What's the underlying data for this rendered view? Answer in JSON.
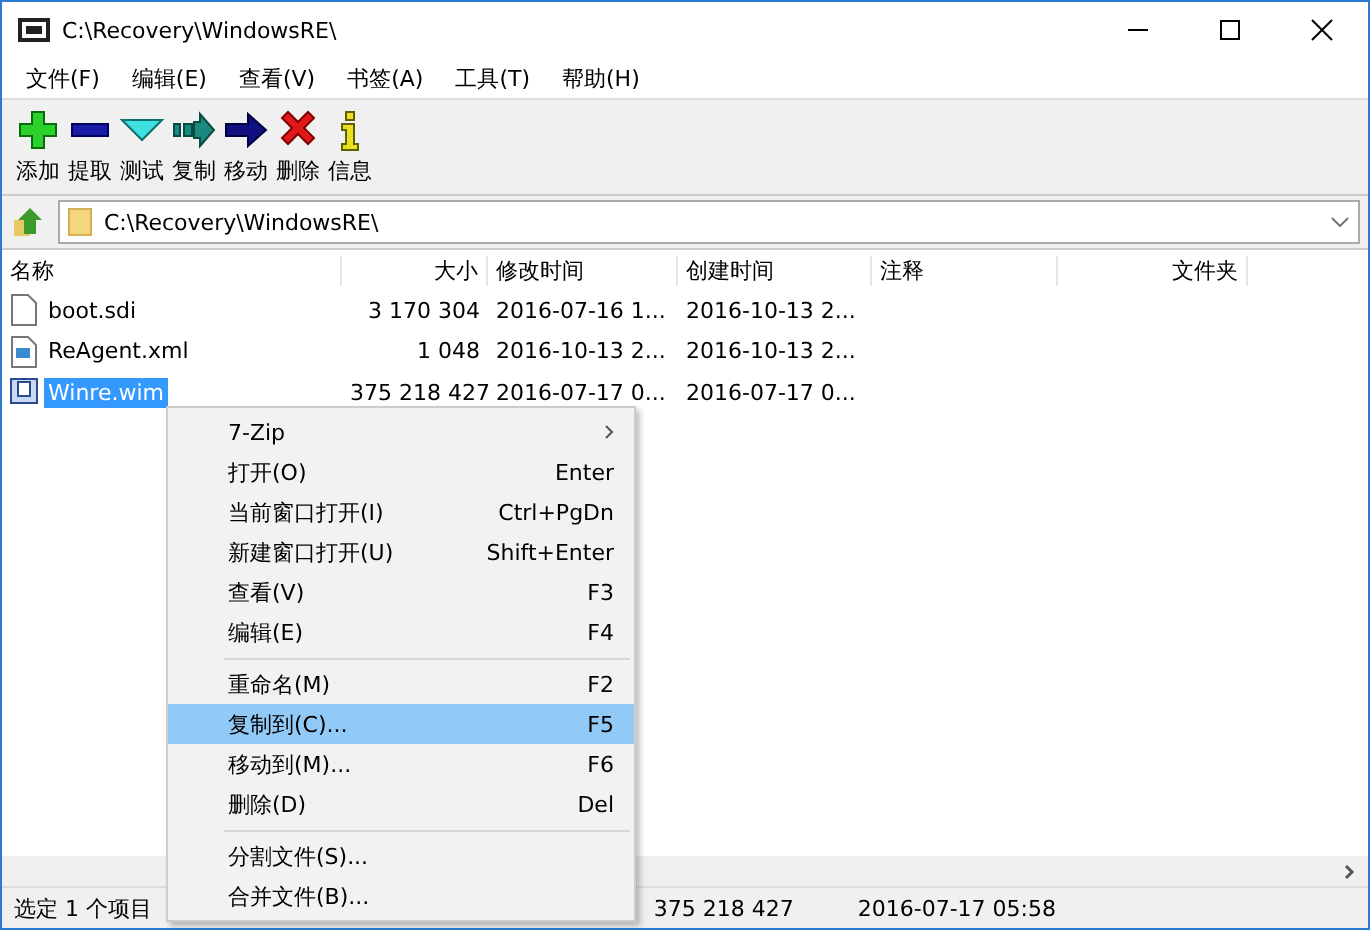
{
  "window": {
    "title": "C:\\Recovery\\WindowsRE\\"
  },
  "menu_bar": [
    "文件(F)",
    "编辑(E)",
    "查看(V)",
    "书签(A)",
    "工具(T)",
    "帮助(H)"
  ],
  "toolbar": [
    {
      "kind": "add",
      "label": "添加"
    },
    {
      "kind": "extract",
      "label": "提取"
    },
    {
      "kind": "test",
      "label": "测试"
    },
    {
      "kind": "copy",
      "label": "复制"
    },
    {
      "kind": "move",
      "label": "移动"
    },
    {
      "kind": "delete",
      "label": "删除"
    },
    {
      "kind": "info",
      "label": "信息"
    }
  ],
  "address": {
    "value": "C:\\Recovery\\WindowsRE\\"
  },
  "table": {
    "columns": [
      {
        "label": "名称"
      },
      {
        "label": "大小"
      },
      {
        "label": "修改时间"
      },
      {
        "label": "创建时间"
      },
      {
        "label": "注释"
      },
      {
        "label": "文件夹"
      }
    ],
    "rows": [
      {
        "kind": "file",
        "name": "boot.sdi",
        "size": "3 170 304",
        "modified": "2016-07-16 1...",
        "created": "2016-10-13 2...",
        "selected": false
      },
      {
        "kind": "xml",
        "name": "ReAgent.xml",
        "size": "1 048",
        "modified": "2016-10-13 2...",
        "created": "2016-10-13 2...",
        "selected": false
      },
      {
        "kind": "archive",
        "name": "Winre.wim",
        "size": "375 218 427",
        "modified": "2016-07-17 0...",
        "created": "2016-07-17 0...",
        "selected": true
      }
    ]
  },
  "context_menu": {
    "groups": [
      [
        {
          "label": "7-Zip",
          "submenu": true,
          "selected": false
        },
        {
          "label": "打开(O)",
          "shortcut": "Enter",
          "submenu": false,
          "selected": false
        },
        {
          "label": "当前窗口打开(I)",
          "shortcut": "Ctrl+PgDn",
          "submenu": false,
          "selected": false
        },
        {
          "label": "新建窗口打开(U)",
          "shortcut": "Shift+Enter",
          "submenu": false,
          "selected": false
        },
        {
          "label": "查看(V)",
          "shortcut": "F3",
          "submenu": false,
          "selected": false
        },
        {
          "label": "编辑(E)",
          "shortcut": "F4",
          "submenu": false,
          "selected": false
        }
      ],
      [
        {
          "label": "重命名(M)",
          "shortcut": "F2",
          "submenu": false,
          "selected": false
        },
        {
          "label": "复制到(C)...",
          "shortcut": "F5",
          "submenu": false,
          "selected": true
        },
        {
          "label": "移动到(M)...",
          "shortcut": "F6",
          "submenu": false,
          "selected": false
        },
        {
          "label": "删除(D)",
          "shortcut": "Del",
          "submenu": false,
          "selected": false
        }
      ],
      [
        {
          "label": "分割文件(S)...",
          "submenu": false,
          "selected": false
        },
        {
          "label": "合并文件(B)...",
          "submenu": false,
          "selected": false
        }
      ]
    ]
  },
  "status_bar": [
    "选定 1 个项目",
    "375 218 427",
    "2016-07-17 05:58"
  ]
}
